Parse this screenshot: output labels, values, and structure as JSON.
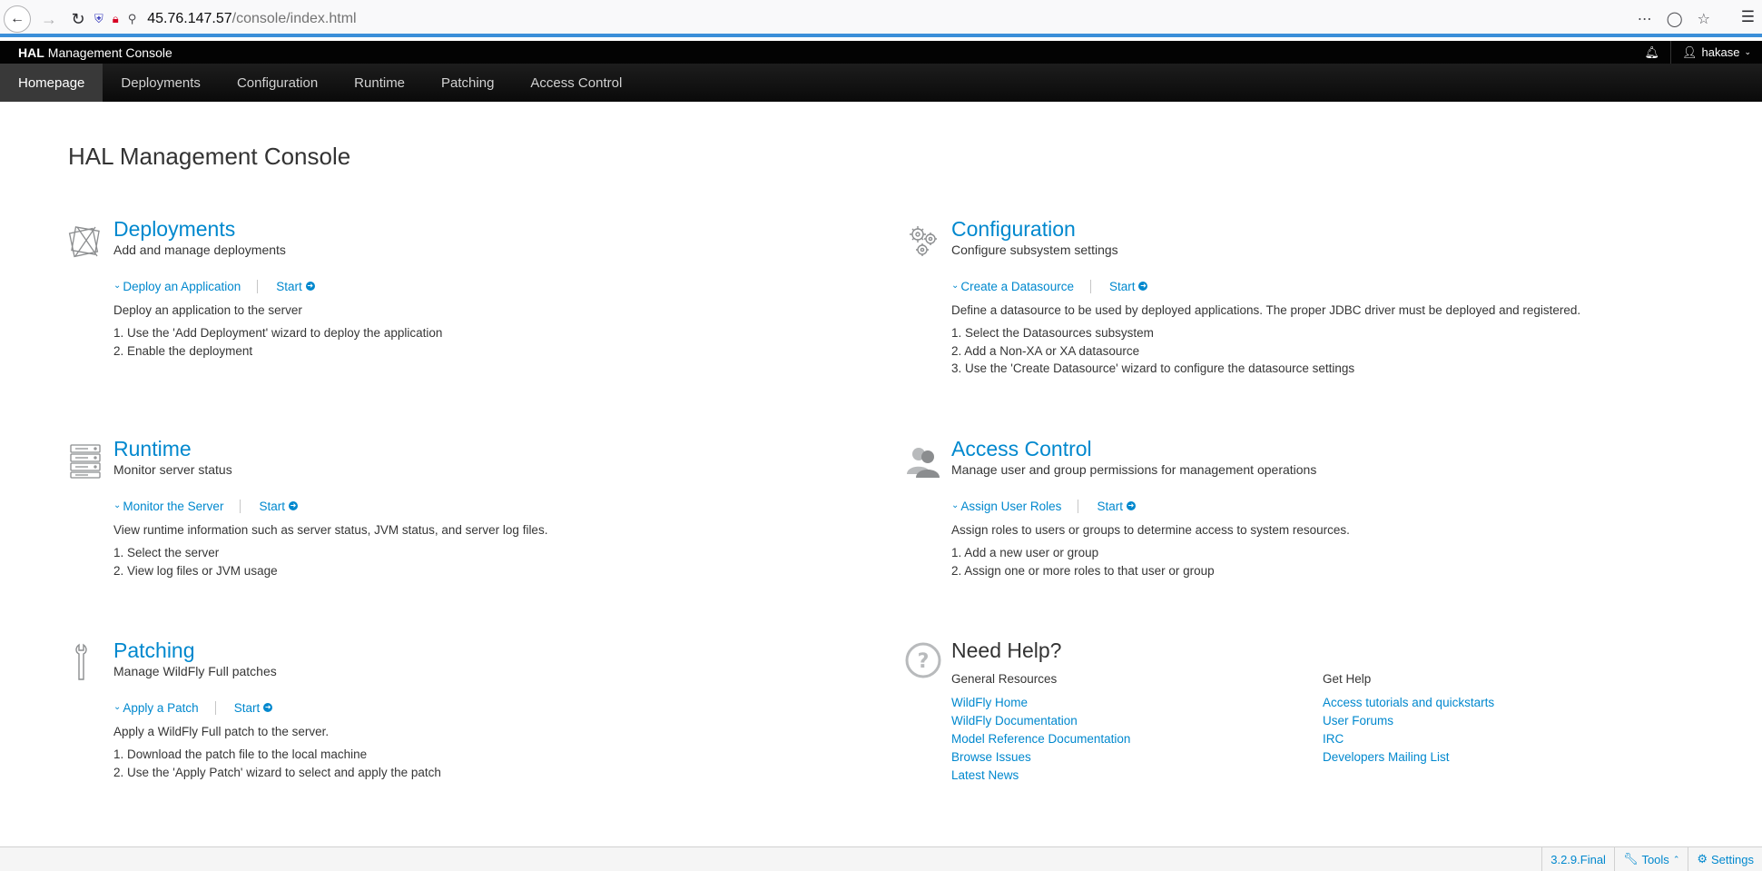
{
  "browser": {
    "url_host": "45.76.147.57",
    "url_path": "/console/index.html"
  },
  "header": {
    "brand_bold": "HAL",
    "brand_rest": "Management Console",
    "user": "hakase"
  },
  "nav": {
    "items": [
      {
        "label": "Homepage",
        "active": true
      },
      {
        "label": "Deployments"
      },
      {
        "label": "Configuration"
      },
      {
        "label": "Runtime"
      },
      {
        "label": "Patching"
      },
      {
        "label": "Access Control"
      }
    ]
  },
  "page_title": "HAL Management Console",
  "modules": {
    "deployments": {
      "title": "Deployments",
      "subtitle": "Add and manage deployments",
      "toggle": "Deploy an Application",
      "start": "Start",
      "description": "Deploy an application to the server",
      "steps": [
        "1. Use the 'Add Deployment' wizard to deploy the application",
        "2. Enable the deployment"
      ]
    },
    "configuration": {
      "title": "Configuration",
      "subtitle": "Configure subsystem settings",
      "toggle": "Create a Datasource",
      "start": "Start",
      "description": "Define a datasource to be used by deployed applications. The proper JDBC driver must be deployed and registered.",
      "steps": [
        "1. Select the Datasources subsystem",
        "2. Add a Non-XA or XA datasource",
        "3. Use the 'Create Datasource' wizard to configure the datasource settings"
      ]
    },
    "runtime": {
      "title": "Runtime",
      "subtitle": "Monitor server status",
      "toggle": "Monitor the Server",
      "start": "Start",
      "description": "View runtime information such as server status, JVM status, and server log files.",
      "steps": [
        "1. Select the server",
        "2. View log files or JVM usage"
      ]
    },
    "access_control": {
      "title": "Access Control",
      "subtitle": "Manage user and group permissions for management operations",
      "toggle": "Assign User Roles",
      "start": "Start",
      "description": "Assign roles to users or groups to determine access to system resources.",
      "steps": [
        "1. Add a new user or group",
        "2. Assign one or more roles to that user or group"
      ]
    },
    "patching": {
      "title": "Patching",
      "subtitle": "Manage WildFly Full patches",
      "toggle": "Apply a Patch",
      "start": "Start",
      "description": "Apply a WildFly Full patch to the server.",
      "steps": [
        "1. Download the patch file to the local machine",
        "2. Use the 'Apply Patch' wizard to select and apply the patch"
      ]
    }
  },
  "help": {
    "title": "Need Help?",
    "general": {
      "heading": "General Resources",
      "links": [
        "WildFly Home",
        "WildFly Documentation",
        "Model Reference Documentation",
        "Browse Issues",
        "Latest News"
      ]
    },
    "get_help": {
      "heading": "Get Help",
      "links": [
        "Access tutorials and quickstarts",
        "User Forums",
        "IRC",
        "Developers Mailing List"
      ]
    }
  },
  "footer": {
    "version": "3.2.9.Final",
    "tools": "Tools",
    "settings": "Settings"
  }
}
